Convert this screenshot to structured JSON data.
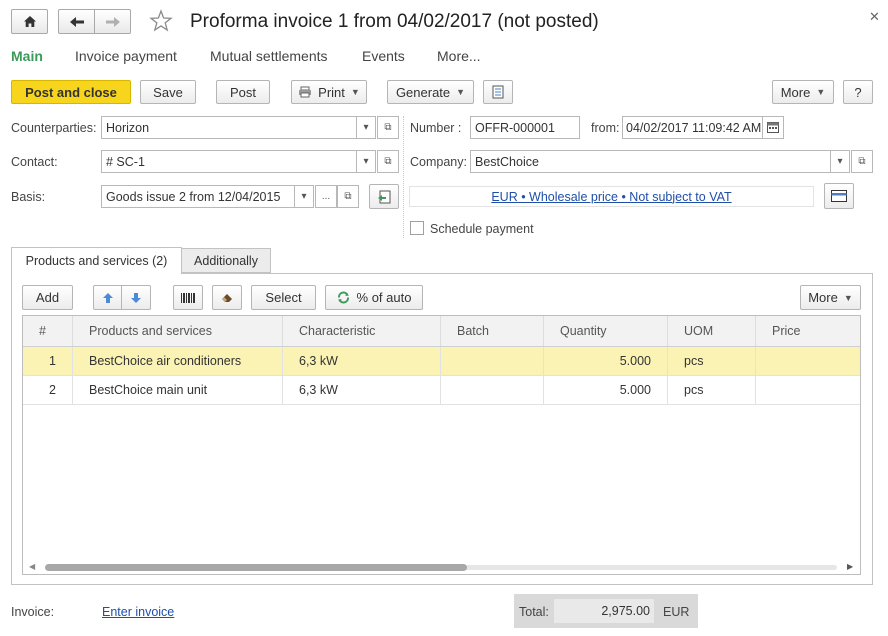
{
  "header": {
    "title": "Proforma invoice 1 from 04/02/2017 (not posted)"
  },
  "tabs": [
    {
      "label": "Main"
    },
    {
      "label": "Invoice payment"
    },
    {
      "label": "Mutual settlements"
    },
    {
      "label": "Events"
    },
    {
      "label": "More..."
    }
  ],
  "toolbar": {
    "post_close": "Post and close",
    "save": "Save",
    "post": "Post",
    "print": "Print",
    "generate": "Generate",
    "more": "More",
    "help": "?"
  },
  "form": {
    "counterparties_label": "Counterparties:",
    "counterparties_value": "Horizon",
    "contact_label": "Contact:",
    "contact_value": "# SC-1",
    "basis_label": "Basis:",
    "basis_value": "Goods issue 2 from 12/04/2015",
    "number_label": "Number :",
    "number_value": "OFFR-000001",
    "from_label": "from:",
    "from_value": "04/02/2017 11:09:42 AM",
    "company_label": "Company:",
    "company_value": "BestChoice",
    "price_link": "EUR • Wholesale price • Not subject to VAT",
    "schedule_payment": "Schedule payment"
  },
  "subtabs": [
    {
      "label": "Products and services (2)"
    },
    {
      "label": "Additionally"
    }
  ],
  "table_toolbar": {
    "add": "Add",
    "select": "Select",
    "percent_auto": "% of auto",
    "more": "More"
  },
  "table": {
    "columns": [
      "#",
      "Products and services",
      "Characteristic",
      "Batch",
      "Quantity",
      "UOM",
      "Price"
    ],
    "rows": [
      {
        "n": "1",
        "product": "BestChoice air conditioners",
        "characteristic": "6,3 kW",
        "batch": "",
        "quantity": "5.000",
        "uom": "pcs",
        "price": ""
      },
      {
        "n": "2",
        "product": "BestChoice main unit",
        "characteristic": "6,3 kW",
        "batch": "",
        "quantity": "5.000",
        "uom": "pcs",
        "price": ""
      }
    ]
  },
  "footer": {
    "invoice_label": "Invoice:",
    "invoice_link": "Enter invoice",
    "total_label": "Total:",
    "total_value": "2,975.00",
    "currency": "EUR"
  },
  "colors": {
    "primary_button": "#f7d51d",
    "active_tab": "#3d9a5b",
    "selected_row": "#fbf3b4",
    "link": "#1f4fa8"
  },
  "icons": [
    "home-icon",
    "back-arrow-icon",
    "forward-arrow-icon",
    "star-icon",
    "close-icon",
    "printer-icon",
    "document-icon",
    "link-icon",
    "arrow-up-icon",
    "arrow-down-icon",
    "barcode-icon",
    "eraser-icon",
    "refresh-icon",
    "calendar-icon",
    "card-icon"
  ]
}
